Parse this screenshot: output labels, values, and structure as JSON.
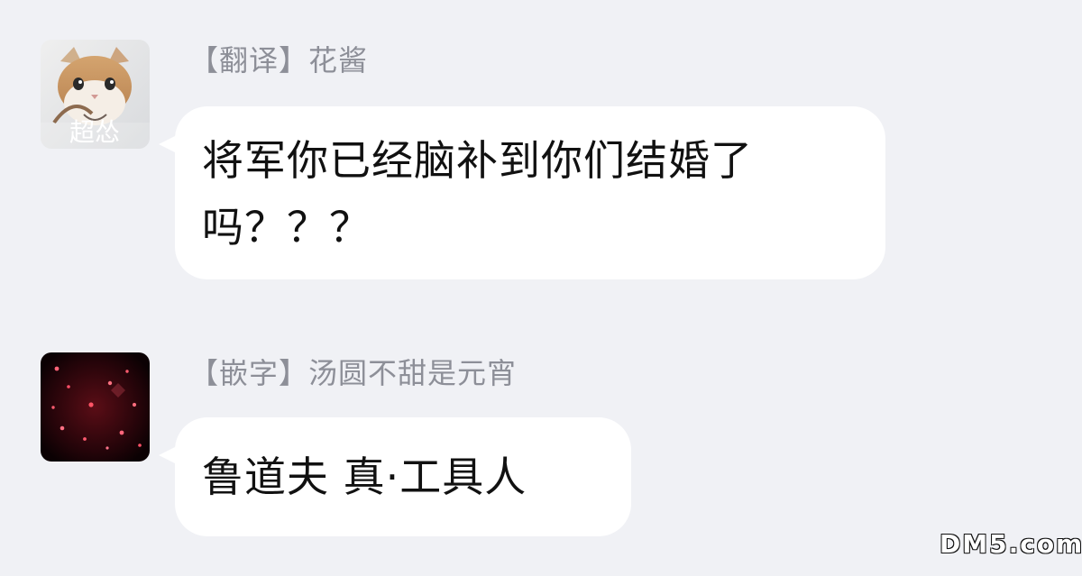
{
  "chat": {
    "messages": [
      {
        "avatar_label": "超怂",
        "sender": "【翻译】花酱",
        "text_lines": [
          "将军你已经脑补到你们结婚了",
          "吗？？？"
        ]
      },
      {
        "sender": "【嵌字】汤圆不甜是元宵",
        "text_lines": [
          "鲁道夫  真·工具人"
        ]
      }
    ]
  },
  "watermark": {
    "text": "DM5.com"
  },
  "colors": {
    "background": "#f0f1f5",
    "bubble": "#ffffff",
    "sender_name": "#8d8f98",
    "message_text": "#111111"
  },
  "icons": {
    "message_1_avatar": "cat-avatar-icon",
    "message_2_avatar": "dark-sparkle-avatar-icon",
    "watermark_logo": "dm5-logo-icon"
  }
}
